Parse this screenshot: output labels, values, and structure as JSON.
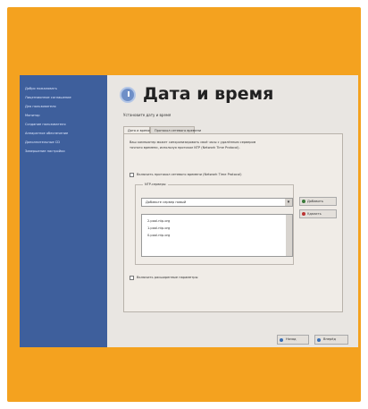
{
  "colors": {
    "frame": "#f4a21f",
    "sidebar": "#3e5f9c",
    "window": "#e9e6e2",
    "panel": "#f0ece7"
  },
  "sidebar": {
    "items": [
      "Добро пожаловать",
      "Лицензионное соглашение",
      "Для пользователя",
      "Монитор",
      "Создание пользователя",
      "Аппаратное обеспечение",
      "Дополнительные CD",
      "Завершение настройки"
    ]
  },
  "main": {
    "icon": "clock-icon",
    "title": "Дата и время",
    "subtitle": "Установите дату и время",
    "tabs": [
      {
        "label": "Дата и время",
        "active": true
      },
      {
        "label": "Протокол сетевого времени",
        "active": false
      }
    ],
    "description": "Ваш компьютер может синхронизировать своё часы с удалённым сервером точного времени, используя протокол NTP (Network Time Protocol).",
    "ntp_checkbox_label": "Включить протокол сетевого времени (Network Time Protocol)",
    "ntp_checked": false,
    "servers_group_title": "NTP-серверы",
    "server_combo_value": "Добавьте сервер новый",
    "servers": [
      "2.pool.ntp.org",
      "1.pool.ntp.org",
      "0.pool.ntp.org"
    ],
    "add_button": "Добавить",
    "delete_button": "Удалить",
    "sync_checkbox_label": "Включить расширенные параметры",
    "back_button": "Назад",
    "forward_button": "Вперёд"
  }
}
